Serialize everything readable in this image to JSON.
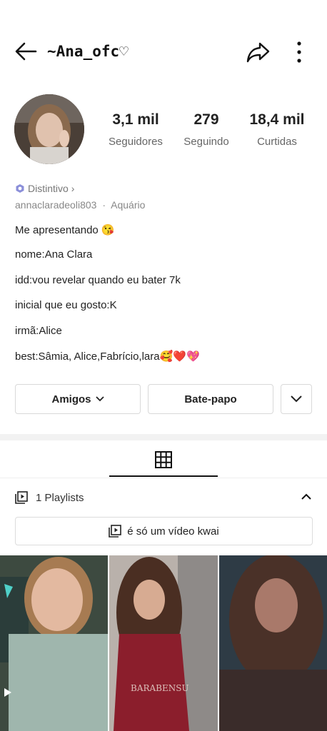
{
  "header": {
    "title": "~Ana_ofc♡"
  },
  "stats": [
    {
      "value": "3,1 mil",
      "label": "Seguidores"
    },
    {
      "value": "279",
      "label": "Seguindo"
    },
    {
      "value": "18,4 mil",
      "label": "Curtidas"
    }
  ],
  "profile": {
    "badge": "Distintivo",
    "badge_chevron": "›",
    "username": "annaclaradeoli803",
    "separator": "·",
    "sign": "Aquário"
  },
  "bio": [
    "Me apresentando 😘",
    "nome:Ana Clara",
    "idd:vou revelar quando eu bater 7k",
    "inicial que eu gosto:K",
    "irmã:Alice",
    "best:Sâmia, Alice,Fabrício,lara🥰❤️💖"
  ],
  "actions": {
    "friends": "Amigos",
    "chat": "Bate-papo"
  },
  "playlists": {
    "label": "1 Playlists",
    "item": "é só um vídeo kwai"
  },
  "thumbnail_caption": "BARABENSU",
  "colors": {
    "badge": "#8b8fd9",
    "divider": "#f2f2f2",
    "text": "#222222"
  }
}
